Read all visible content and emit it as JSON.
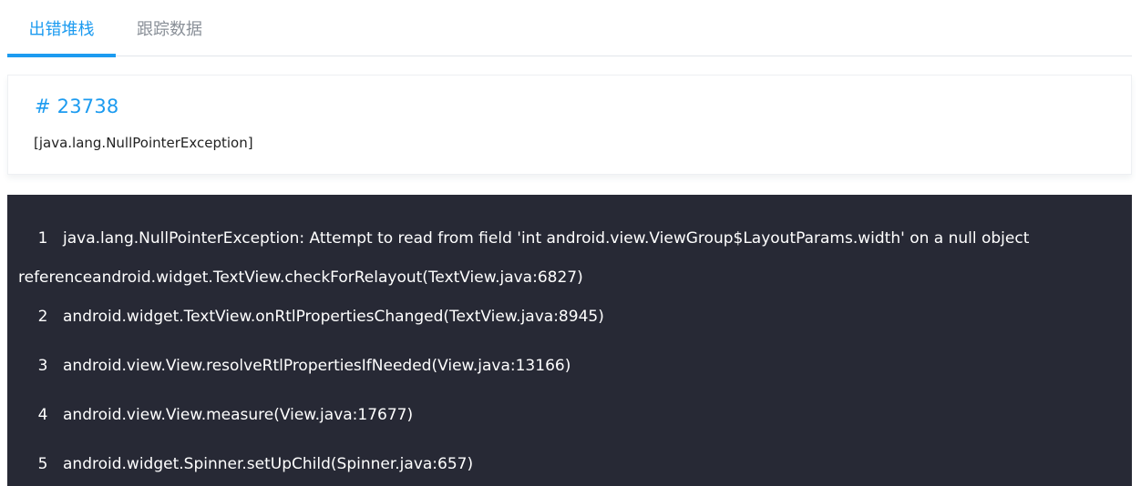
{
  "tabs": {
    "stack_label": "出错堆栈",
    "trace_label": "跟踪数据"
  },
  "error": {
    "id": "# 23738",
    "type": "[java.lang.NullPointerException]"
  },
  "stack": {
    "lines": [
      {
        "num": "1",
        "text": "java.lang.NullPointerException: Attempt to read from field 'int android.view.ViewGroup$LayoutParams.width' on a null object",
        "continuation": "referenceandroid.widget.TextView.checkForRelayout(TextView.java:6827)"
      },
      {
        "num": "2",
        "text": "android.widget.TextView.onRtlPropertiesChanged(TextView.java:8945)"
      },
      {
        "num": "3",
        "text": "android.view.View.resolveRtlPropertiesIfNeeded(View.java:13166)"
      },
      {
        "num": "4",
        "text": "android.view.View.measure(View.java:17677)"
      },
      {
        "num": "5",
        "text": "android.widget.Spinner.setUpChild(Spinner.java:657)"
      }
    ]
  }
}
